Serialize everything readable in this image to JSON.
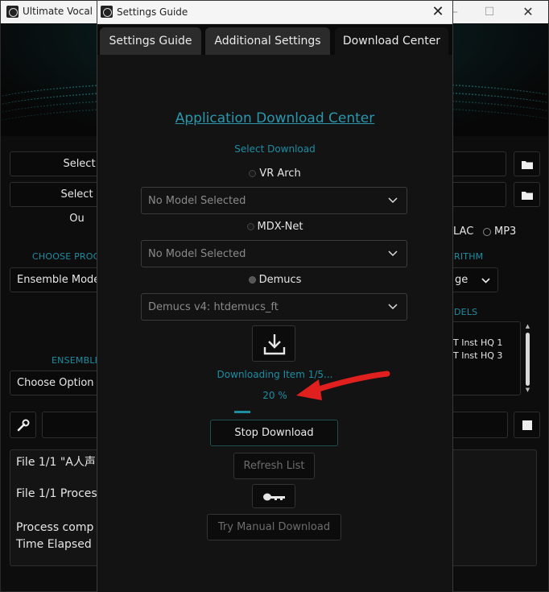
{
  "main_window": {
    "title": "Ultimate Vocal Re",
    "select_input_label": "Select In",
    "select_output_label": "Select Ou",
    "choose_process_label": "CHOOSE PROC",
    "process_value": "Ensemble Mode",
    "ensemble_label": "ENSEMBLE",
    "ensemble_value": "Choose Option",
    "format_flac": "LAC",
    "format_mp3": "MP3",
    "algorithm_label": "RITHM",
    "algorithm_value": "ge",
    "models_label": "DELS",
    "model_list": [
      "T Inst HQ 1",
      "T Inst HQ 3"
    ],
    "log_lines": [
      "File 1/1 \"A人声",
      "File 1/1 Proces",
      "Process comp",
      "Time Elapsed"
    ]
  },
  "dialog": {
    "title": "Settings Guide",
    "tabs": [
      {
        "label": "Settings Guide",
        "active": false
      },
      {
        "label": "Additional Settings",
        "active": false
      },
      {
        "label": "Download Center",
        "active": true
      }
    ],
    "download_center": {
      "title": "Application Download Center",
      "select_label": "Select Download",
      "options": [
        {
          "label": "VR Arch",
          "selected": false,
          "combo_value": "No Model Selected"
        },
        {
          "label": "MDX-Net",
          "selected": false,
          "combo_value": "No Model Selected"
        },
        {
          "label": "Demucs",
          "selected": true,
          "combo_value": "Demucs v4: htdemucs_ft"
        }
      ],
      "status": "Downloading Item 1/5...",
      "percent_text": "20 %",
      "progress": 0.2,
      "stop_button": "Stop Download",
      "refresh_button": "Refresh List",
      "manual_button": "Try Manual Download"
    }
  },
  "colors": {
    "accent": "#1e8da2",
    "annotation_arrow": "#e0201f"
  }
}
